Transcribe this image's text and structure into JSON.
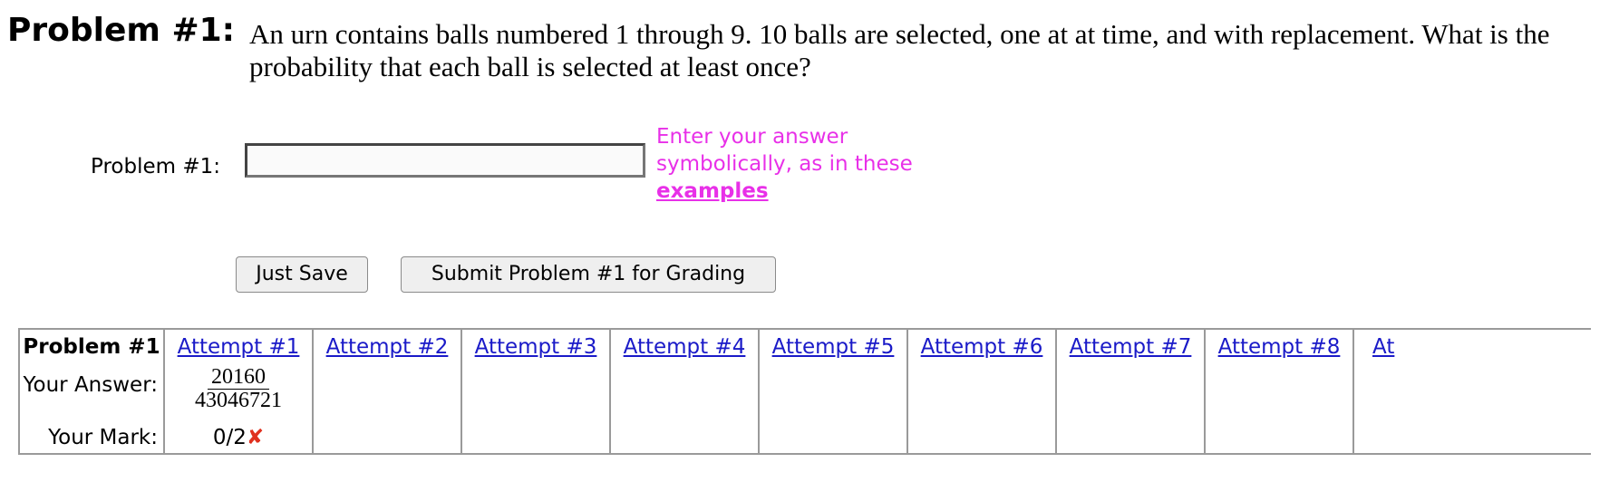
{
  "problem": {
    "label": "Problem #1:",
    "text": "An urn contains balls numbered 1 through 9. 10 balls are selected, one at at time, and with replacement. What is the probability that each ball is selected at least once?"
  },
  "answer": {
    "label": "Problem #1:",
    "value": "",
    "placeholder": "",
    "hint_line1": "Enter your answer",
    "hint_line2": "symbolically, as in these",
    "hint_link": "examples"
  },
  "buttons": {
    "save": "Just Save",
    "submit": "Submit Problem #1 for Grading"
  },
  "attempts_table": {
    "title": "Problem #1",
    "row_answer_label": "Your Answer:",
    "row_mark_label": "Your Mark:",
    "attempts": [
      {
        "label": "Attempt #1",
        "answer_numerator": "20160",
        "answer_denominator": "43046721",
        "mark": "0/2",
        "mark_icon": "✘"
      },
      {
        "label": "Attempt #2"
      },
      {
        "label": "Attempt #3"
      },
      {
        "label": "Attempt #4"
      },
      {
        "label": "Attempt #5"
      },
      {
        "label": "Attempt #6"
      },
      {
        "label": "Attempt #7"
      },
      {
        "label": "Attempt #8"
      },
      {
        "label": "At"
      }
    ]
  },
  "colors": {
    "hint": "#e830e8",
    "link": "#1a1ac8",
    "wrong_mark": "#e0301e"
  }
}
